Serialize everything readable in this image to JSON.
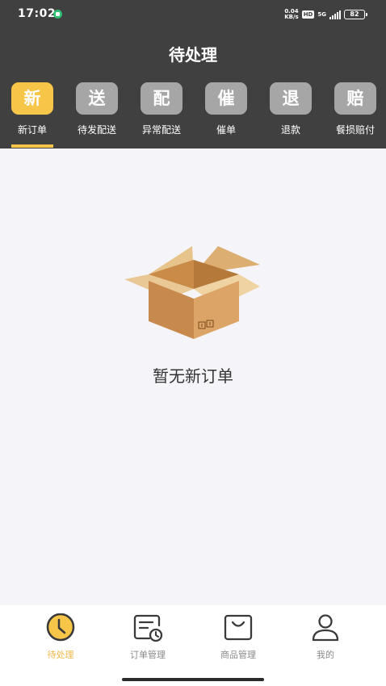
{
  "status_bar": {
    "time": "17:02",
    "net_speed_value": "0.04",
    "net_speed_unit": "KB/s",
    "hd": "HD",
    "network": "5G",
    "battery": "82"
  },
  "header": {
    "title": "待处理"
  },
  "tabs": [
    {
      "icon_char": "新",
      "label": "新订单",
      "active": true
    },
    {
      "icon_char": "送",
      "label": "待发配送",
      "active": false
    },
    {
      "icon_char": "配",
      "label": "异常配送",
      "active": false
    },
    {
      "icon_char": "催",
      "label": "催单",
      "active": false
    },
    {
      "icon_char": "退",
      "label": "退款",
      "active": false
    },
    {
      "icon_char": "赔",
      "label": "餐损赔付",
      "active": false
    }
  ],
  "empty_state": {
    "icon": "empty-box-icon",
    "message": "暂无新订单"
  },
  "bottom_nav": [
    {
      "icon": "clock-icon",
      "label": "待处理",
      "active": true
    },
    {
      "icon": "order-manage-icon",
      "label": "订单管理",
      "active": false
    },
    {
      "icon": "shopping-bag-icon",
      "label": "商品管理",
      "active": false
    },
    {
      "icon": "person-icon",
      "label": "我的",
      "active": false
    }
  ],
  "colors": {
    "header_bg": "#404040",
    "accent": "#f7c548",
    "tab_inactive": "#a6a6a6",
    "nav_active": "#f2b84b",
    "page_bg": "#f5f5f9"
  }
}
